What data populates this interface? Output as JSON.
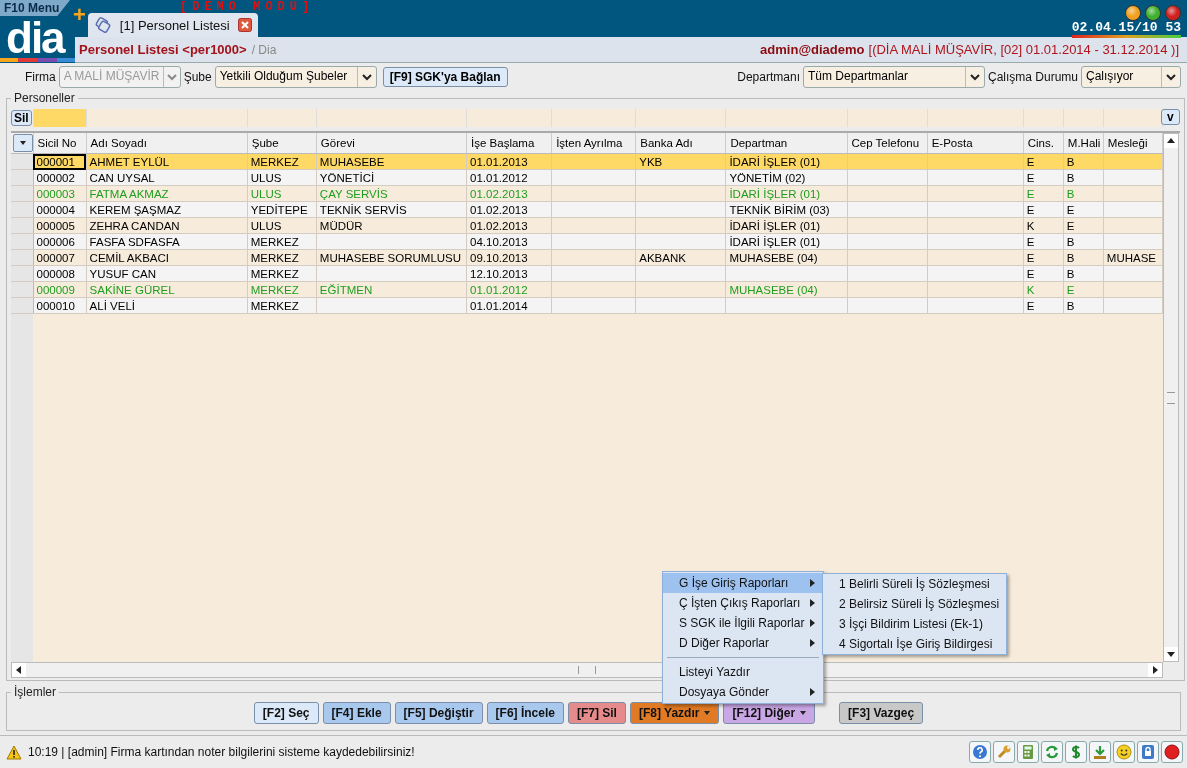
{
  "menu_button": "F10 Menu",
  "logo": "dia",
  "new_tab_button": "+",
  "demo_banner": "[DEMO  MODU]",
  "tabs": [
    {
      "label": "[1] Personel Listesi",
      "selected": true
    }
  ],
  "clock": "02.04.15/10 53",
  "breadcrumb": {
    "title": "Personel Listesi <per1000>",
    "path": "/ Dia"
  },
  "session": {
    "user": "admin@diademo",
    "context": "[(DİA MALİ MÜŞAVİR, [02] 01.01.2014 - 31.12.2014 )]"
  },
  "filters_left": [
    {
      "label": "Firma",
      "value": "A MALİ MÜŞAVİR",
      "disabled": true
    },
    {
      "label": "Şube",
      "value": "Yetkili Olduğum Şubeler",
      "disabled": false
    }
  ],
  "sgk_button": "[F9] SGK'ya Bağlan",
  "filters_right": [
    {
      "label": "Departmanı",
      "value": "Tüm Departmanlar",
      "disabled": false
    },
    {
      "label": "Çalışma Durumu",
      "value": "Çalışıyor",
      "disabled": false
    }
  ],
  "personnel": {
    "title": "Personeller",
    "filter_button": "Sil",
    "column_chooser": "v",
    "columns": [
      "Sicil No",
      "Adı Soyadı",
      "Şube",
      "Görevi",
      "İşe Başlama",
      "İşten Ayrılma",
      "Banka Adı",
      "Departman",
      "Cep Telefonu",
      "E-Posta",
      "Cins.",
      "M.Hali",
      "Mesleği"
    ],
    "rows": [
      {
        "selected": true,
        "cells": [
          "000001",
          "AHMET EYLÜL",
          "MERKEZ",
          "MUHASEBE",
          "01.01.2013",
          null,
          "YKB",
          "İDARİ İŞLER (01)",
          null,
          null,
          "E",
          "B",
          null
        ]
      },
      {
        "selected": false,
        "cells": [
          "000002",
          "CAN UYSAL",
          "ULUS",
          "YÖNETİCİ",
          "01.01.2012",
          null,
          null,
          "YÖNETİM (02)",
          null,
          null,
          "E",
          "B",
          null
        ]
      },
      {
        "selected": false,
        "color": "#1e9e1e",
        "cells": [
          "000003",
          "FATMA AKMAZ",
          "ULUS",
          "ÇAY SERVİS",
          "01.02.2013",
          null,
          null,
          "İDARİ İŞLER (01)",
          null,
          null,
          "E",
          "B",
          null
        ]
      },
      {
        "selected": false,
        "cells": [
          "000004",
          "KEREM ŞAŞMAZ",
          "YEDİTEPE",
          "TEKNİK SERVİS",
          "01.02.2013",
          null,
          null,
          "TEKNİK BİRİM (03)",
          null,
          null,
          "E",
          "E",
          null
        ]
      },
      {
        "selected": false,
        "cells": [
          "000005",
          "ZEHRA CANDAN",
          "ULUS",
          "MÜDÜR",
          "01.02.2013",
          null,
          null,
          "İDARİ İŞLER (01)",
          null,
          null,
          "K",
          "E",
          null
        ]
      },
      {
        "selected": false,
        "cells": [
          "000006",
          "FASFA SDFASFA",
          "MERKEZ",
          null,
          "04.10.2013",
          null,
          null,
          "İDARİ İŞLER (01)",
          null,
          null,
          "E",
          "B",
          null
        ]
      },
      {
        "selected": false,
        "cells": [
          "000007",
          "CEMİL AKBACI",
          "MERKEZ",
          "MUHASEBE SORUMLUSU",
          "09.10.2013",
          null,
          "AKBANK",
          "MUHASEBE (04)",
          null,
          null,
          "E",
          "B",
          "MUHASE"
        ]
      },
      {
        "selected": false,
        "cells": [
          "000008",
          "YUSUF CAN",
          "MERKEZ",
          null,
          "12.10.2013",
          null,
          null,
          null,
          null,
          null,
          "E",
          "B",
          null
        ]
      },
      {
        "selected": false,
        "color": "#1e9e1e",
        "cells": [
          "000009",
          "SAKİNE GÜREL",
          "MERKEZ",
          "EĞİTMEN",
          "01.01.2012",
          null,
          null,
          "MUHASEBE (04)",
          null,
          null,
          "K",
          "E",
          null
        ]
      },
      {
        "selected": false,
        "cells": [
          "000010",
          "ALİ VELİ",
          "MERKEZ",
          null,
          "01.01.2014",
          null,
          null,
          null,
          null,
          null,
          "E",
          "B",
          null
        ]
      }
    ]
  },
  "actions": {
    "title": "İşlemler",
    "buttons": [
      {
        "label": "[F2] Seç",
        "color": "#dce9f8",
        "dropdown": false
      },
      {
        "label": "[F4] Ekle",
        "color": "#a9c8ee",
        "dropdown": false
      },
      {
        "label": "[F5] Değiştir",
        "color": "#a9c8ee",
        "dropdown": false
      },
      {
        "label": "[F6] İncele",
        "color": "#a9c8ee",
        "dropdown": false
      },
      {
        "label": "[F7] Sil",
        "color": "#e58b8b",
        "dropdown": false
      },
      {
        "label": "[F8] Yazdır",
        "color": "#e07a24",
        "dropdown": true
      },
      {
        "label": "[F12] Diğer",
        "color": "#c9a6e4",
        "dropdown": true
      },
      {
        "label": "[F3] Vazgeç",
        "color": "#c8c8c8",
        "dropdown": false
      }
    ]
  },
  "print_menu": {
    "items": [
      {
        "kind": "item",
        "label": "G İşe Giriş Raporları",
        "submenu": true,
        "selected": true
      },
      {
        "kind": "item",
        "label": "Ç İşten Çıkış Raporları",
        "submenu": true,
        "selected": false
      },
      {
        "kind": "item",
        "label": "S SGK ile İlgili Raporlar",
        "submenu": true,
        "selected": false
      },
      {
        "kind": "item",
        "label": "D Diğer Raporlar",
        "submenu": true,
        "selected": false
      },
      {
        "kind": "separator"
      },
      {
        "kind": "item",
        "label": "Listeyi Yazdır",
        "submenu": false,
        "selected": false
      },
      {
        "kind": "item",
        "label": "Dosyaya Gönder",
        "submenu": true,
        "selected": false
      }
    ],
    "submenu": {
      "items": [
        {
          "label": "1 Belirli Süreli İş Sözleşmesi",
          "selected": false
        },
        {
          "label": "2 Belirsiz Süreli İş Sözleşmesi",
          "selected": false
        },
        {
          "label": "3 İşçi Bildirim Listesi (Ek-1)",
          "selected": false
        },
        {
          "label": "4 Sigortalı İşe Giriş Bildirgesi",
          "selected": false
        }
      ]
    }
  },
  "status": {
    "message": "10:19 | [admin] Firma kartından noter bilgilerini sisteme kaydedebilirsiniz!"
  }
}
